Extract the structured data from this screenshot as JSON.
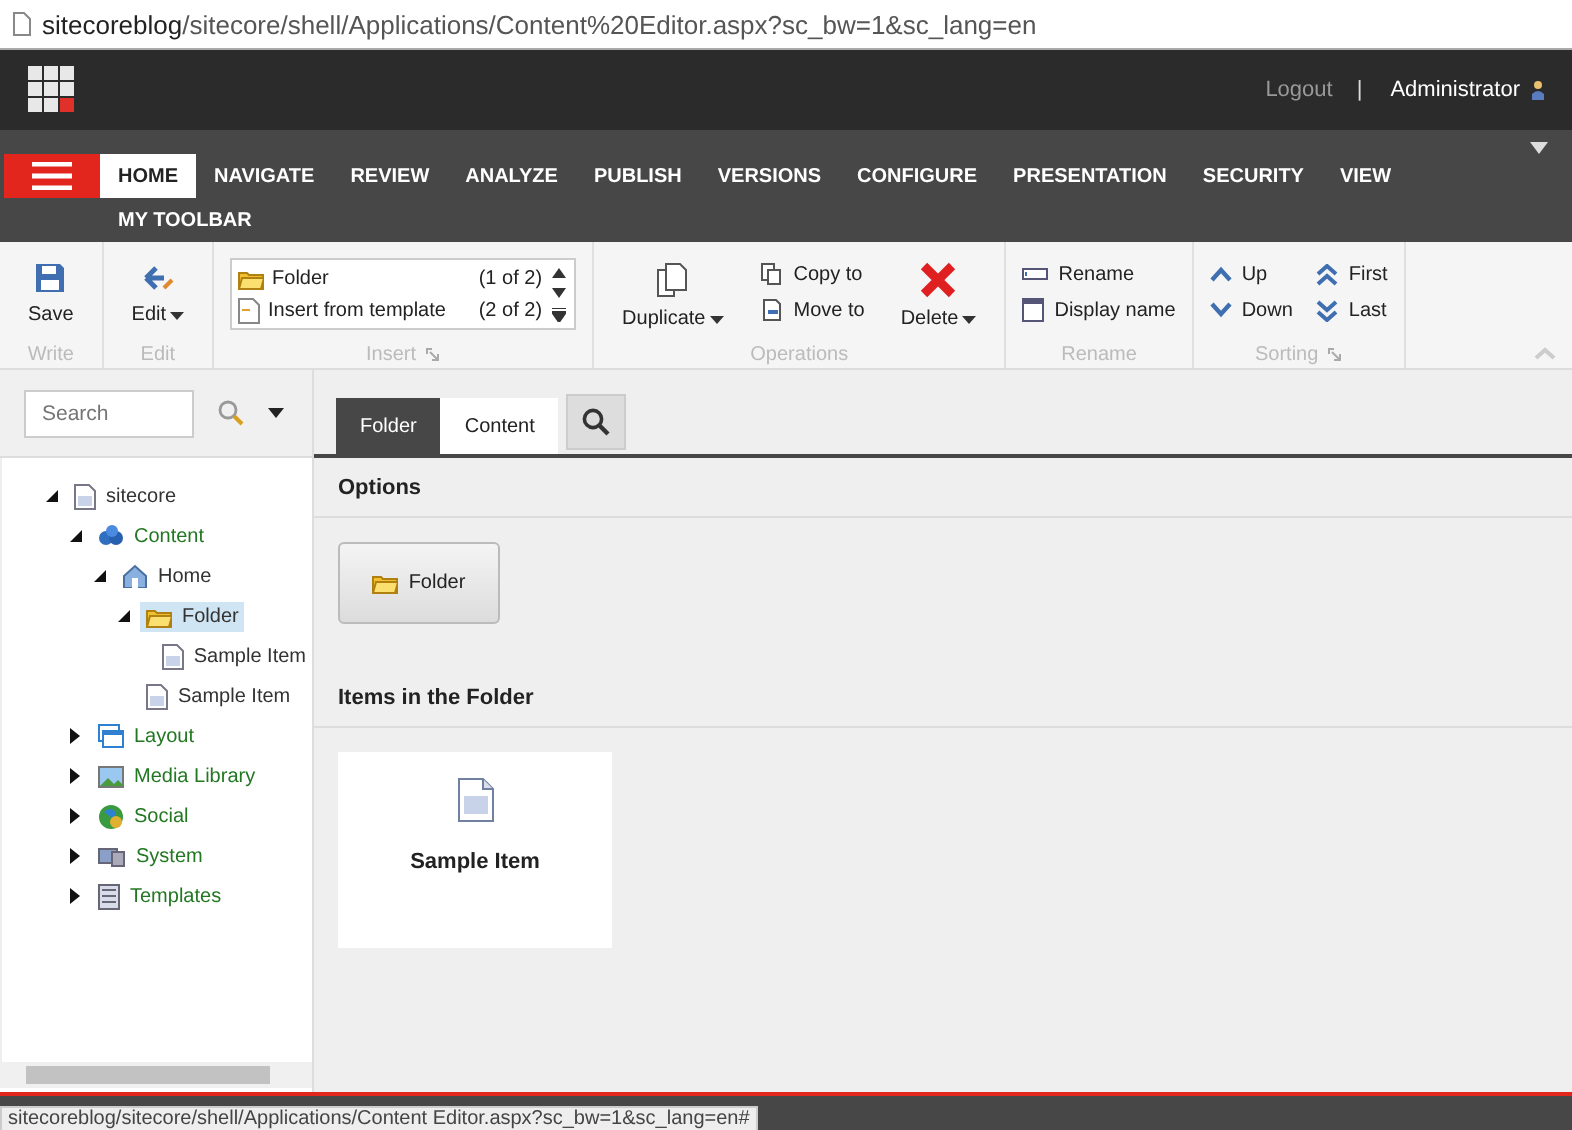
{
  "address_bar": {
    "host": "sitecoreblog",
    "path": "/sitecore/shell/Applications/Content%20Editor.aspx?sc_bw=1&sc_lang=en"
  },
  "header": {
    "logout": "Logout",
    "separator": "|",
    "user": "Administrator"
  },
  "ribbon_tabs": [
    {
      "label": "HOME",
      "selected": true
    },
    {
      "label": "NAVIGATE",
      "selected": false
    },
    {
      "label": "REVIEW",
      "selected": false
    },
    {
      "label": "ANALYZE",
      "selected": false
    },
    {
      "label": "PUBLISH",
      "selected": false
    },
    {
      "label": "VERSIONS",
      "selected": false
    },
    {
      "label": "CONFIGURE",
      "selected": false
    },
    {
      "label": "PRESENTATION",
      "selected": false
    },
    {
      "label": "SECURITY",
      "selected": false
    },
    {
      "label": "VIEW",
      "selected": false
    },
    {
      "label": "MY TOOLBAR",
      "selected": false
    }
  ],
  "ribbon_groups": [
    {
      "label": "Write",
      "launcher": false,
      "controls": [
        {
          "kind": "large",
          "label": "Save",
          "dropdown": false
        }
      ]
    },
    {
      "label": "Edit",
      "launcher": false,
      "controls": [
        {
          "kind": "large",
          "label": "Edit",
          "dropdown": true
        }
      ]
    },
    {
      "label": "Insert",
      "launcher": true,
      "controls": [
        {
          "kind": "list",
          "options": [
            {
              "label": "Folder",
              "count": "(1 of 2)"
            },
            {
              "label": "Insert from template",
              "count": "(2 of 2)"
            }
          ]
        }
      ]
    },
    {
      "label": "Operations",
      "launcher": false,
      "controls": [
        {
          "kind": "large",
          "label": "Duplicate",
          "dropdown": true
        },
        {
          "kind": "stack",
          "items": [
            "Copy to",
            "Move to"
          ]
        },
        {
          "kind": "large",
          "label": "Delete",
          "dropdown": true
        }
      ]
    },
    {
      "label": "Rename",
      "launcher": false,
      "controls": [
        {
          "kind": "stack",
          "items": [
            "Rename",
            "Display name"
          ]
        }
      ]
    },
    {
      "label": "Sorting",
      "launcher": true,
      "controls": [
        {
          "kind": "stack",
          "items": [
            "Up",
            "Down"
          ]
        },
        {
          "kind": "stack",
          "items": [
            "First",
            "Last"
          ]
        }
      ]
    }
  ],
  "search": {
    "placeholder": "Search"
  },
  "tree": [
    {
      "label": "sitecore",
      "expanded": true,
      "selected": false,
      "color": "#333333",
      "children": [
        {
          "label": "Content",
          "expanded": true,
          "selected": false,
          "color": "#227722",
          "children": [
            {
              "label": "Home",
              "expanded": true,
              "selected": false,
              "color": "#333333",
              "children": [
                {
                  "label": "Folder",
                  "expanded": true,
                  "selected": true,
                  "color": "#333333",
                  "children": [
                    {
                      "label": "Sample Item",
                      "selected": false,
                      "color": "#333333"
                    }
                  ]
                },
                {
                  "label": "Sample Item",
                  "selected": false,
                  "color": "#333333"
                }
              ]
            }
          ]
        },
        {
          "label": "Layout",
          "expanded": false,
          "selected": false,
          "color": "#227722"
        },
        {
          "label": "Media Library",
          "expanded": false,
          "selected": false,
          "color": "#227722"
        },
        {
          "label": "Social",
          "expanded": false,
          "selected": false,
          "color": "#227722"
        },
        {
          "label": "System",
          "expanded": false,
          "selected": false,
          "color": "#227722"
        },
        {
          "label": "Templates",
          "expanded": false,
          "selected": false,
          "color": "#227722"
        }
      ]
    }
  ],
  "editor_tabs": [
    {
      "label": "Folder",
      "selected": true
    },
    {
      "label": "Content",
      "selected": false
    }
  ],
  "options": {
    "title": "Options",
    "button": "Folder"
  },
  "items": {
    "title": "Items in the Folder",
    "cards": [
      "Sample Item"
    ]
  },
  "status_bar": {
    "url": "sitecoreblog/sitecore/shell/Applications/Content Editor.aspx?sc_bw=1&sc_lang=en#"
  }
}
